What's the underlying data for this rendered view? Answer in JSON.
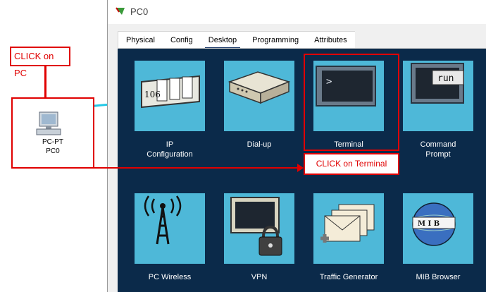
{
  "annotations": {
    "pc": "CLICK on PC",
    "terminal": "CLICK on Terminal"
  },
  "device": {
    "model": "PC-PT",
    "name": "PC0"
  },
  "window": {
    "title": "PC0"
  },
  "tabs": [
    {
      "label": "Physical"
    },
    {
      "label": "Config"
    },
    {
      "label": "Desktop",
      "active": true
    },
    {
      "label": "Programming"
    },
    {
      "label": "Attributes"
    }
  ],
  "apps": [
    {
      "label": "IP\nConfiguration",
      "icon": "ip-config-icon",
      "icon_text": "106"
    },
    {
      "label": "Dial-up",
      "icon": "modem-icon"
    },
    {
      "label": "Terminal",
      "icon": "terminal-icon",
      "icon_text": ">"
    },
    {
      "label": "Command\nPrompt",
      "icon": "command-prompt-icon",
      "icon_text": "run"
    },
    {
      "label": "PC Wireless",
      "icon": "wireless-tower-icon"
    },
    {
      "label": "VPN",
      "icon": "vpn-lock-icon"
    },
    {
      "label": "Traffic Generator",
      "icon": "traffic-generator-icon"
    },
    {
      "label": "MIB Browser",
      "icon": "mib-browser-icon",
      "icon_text": "M I B"
    }
  ],
  "colors": {
    "annotation": "#e00000",
    "desktop_bg": "#0b2a4a",
    "tile_bg": "#4eb8d8",
    "cable": "#22c8e6"
  }
}
